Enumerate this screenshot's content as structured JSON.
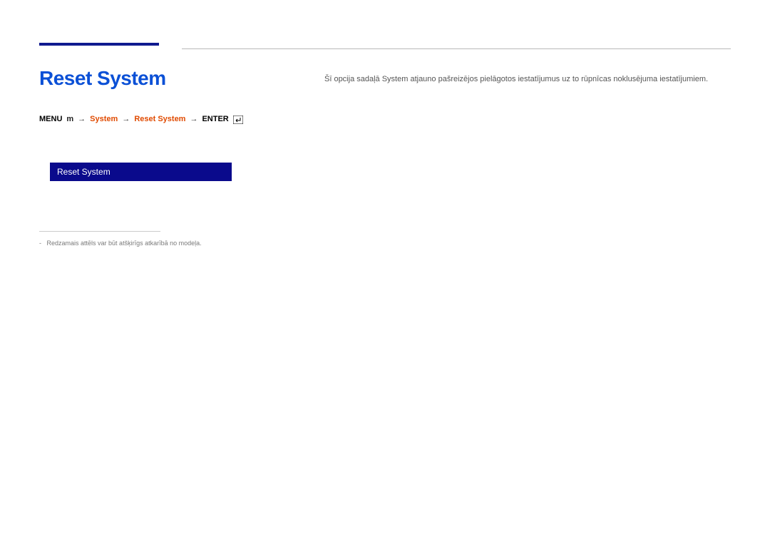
{
  "title": "Reset System",
  "breadcrumb": {
    "menu": "MENU",
    "menu_suffix": "m",
    "arrow": "→",
    "level1": "System",
    "level2": "Reset System",
    "enter": "ENTER"
  },
  "menu_preview": {
    "item": "Reset System"
  },
  "footnote": "Redzamais attēls var būt atšķirīgs atkarībā no modeļa.",
  "description": "Šī opcija sadaļā System atjauno pašreizējos pielāgotos iestatījumus uz to rūpnīcas noklusējuma iestatījumiem."
}
